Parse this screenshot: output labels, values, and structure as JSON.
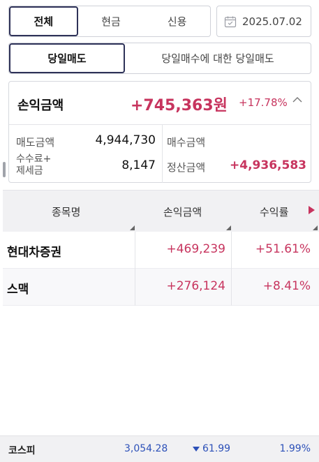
{
  "filters": {
    "segments": [
      "전체",
      "현금",
      "신용"
    ],
    "selected_segment": "전체",
    "date": "2025.07.02"
  },
  "mode_tabs": [
    "당일매도",
    "당일매수에 대한 당일매도"
  ],
  "summary": {
    "pl_label": "손익금액",
    "pl_amount": "+745,363원",
    "pl_rate": "+17.78%",
    "sell_label": "매도금액",
    "sell_value": "4,944,730",
    "buy_label": "매수금액",
    "buy_value": "",
    "fee_label_1": "수수료+",
    "fee_label_2": "제세금",
    "fee_value": "8,147",
    "settle_label": "정산금액",
    "settle_value": "+4,936,583"
  },
  "table": {
    "headers": [
      "종목명",
      "손익금액",
      "수익률"
    ],
    "rows": [
      {
        "name": "현대차증권",
        "pl": "+469,239",
        "rate": "+51.61%"
      },
      {
        "name": "스맥",
        "pl": "+276,124",
        "rate": "+8.41%"
      }
    ]
  },
  "index_bar": {
    "name": "코스피",
    "value": "3,054.28",
    "change": "61.99",
    "rate": "1.99%"
  },
  "colors": {
    "accent": "#2e3258",
    "profit": "#c7345e",
    "down": "#2c50b8"
  }
}
